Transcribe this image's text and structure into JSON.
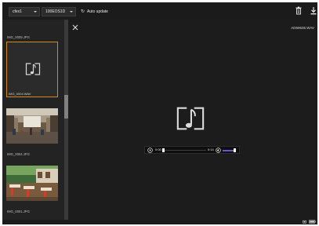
{
  "toolbar": {
    "card_select": "cfex1",
    "folder_select": "100EOS1D",
    "auto_update_label": "Auto update",
    "icons": [
      "refresh-icon",
      "trash-icon",
      "download-icon"
    ]
  },
  "thumbnails": [
    {
      "label": "IMG_0009.JPG",
      "type": "image-label-only"
    },
    {
      "label": "IMG_0004.WAV",
      "type": "audio",
      "selected": true
    },
    {
      "label": "IMG_0004.JPG",
      "type": "image"
    },
    {
      "label": "IMG_0001.JPG",
      "type": "image"
    }
  ],
  "viewer": {
    "filename": "AD69635.WAV",
    "player": {
      "current_time": "0:00",
      "duration": "0:14",
      "position_fraction": 0.0,
      "volume_fraction": 0.9
    }
  },
  "colors": {
    "selection_border": "#d58a17",
    "volume_accent": "#5b5bdb",
    "background": "#1b1b1b"
  }
}
